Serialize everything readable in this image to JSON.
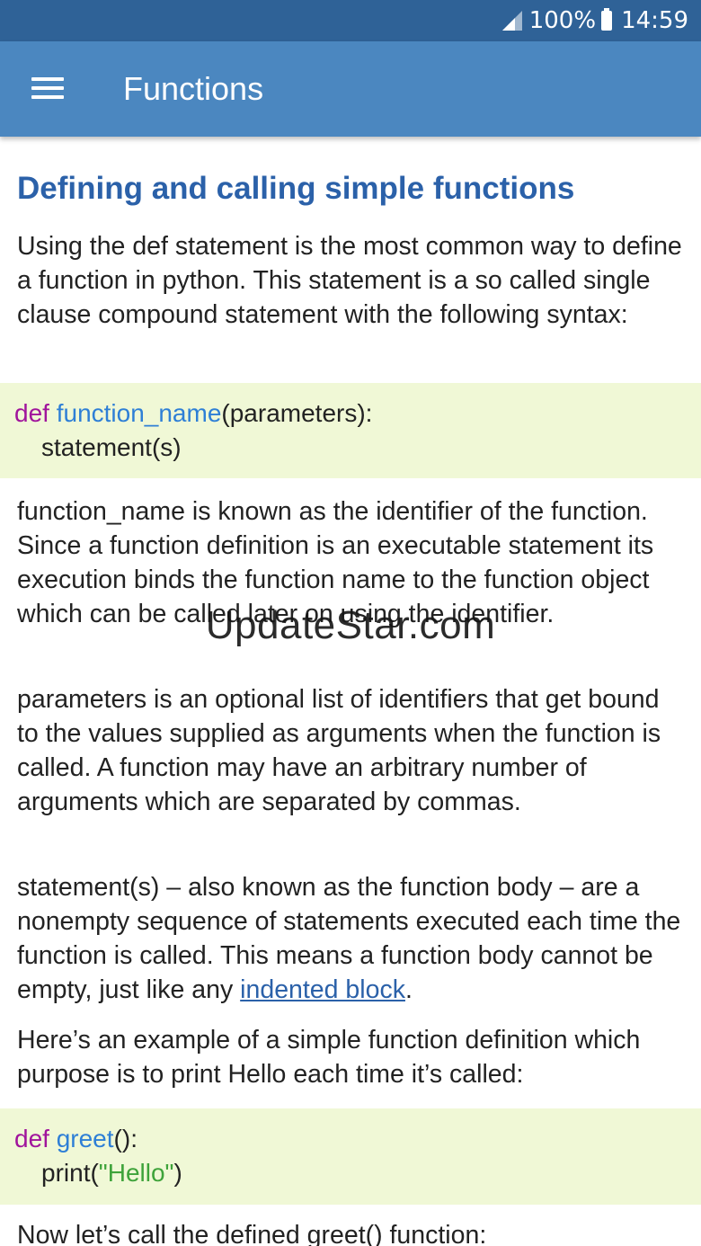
{
  "status_bar": {
    "battery_percent": "100%",
    "time": "14:59",
    "signal_icon": "signal-icon",
    "battery_icon": "battery-icon"
  },
  "app_bar": {
    "menu_icon": "hamburger-menu-icon",
    "title": "Functions"
  },
  "article": {
    "heading": "Defining and calling simple functions",
    "intro": "Using the def statement is the most common way to define a function in python. This statement is a so called single clause compound statement with the following syntax:",
    "code1": {
      "line1": {
        "kw": "def",
        "fn": " function_name",
        "rest": "(parameters):"
      },
      "line2": "statement(s)"
    },
    "para_function_name": "function_name is known as the identifier of the function. Since a function definition is an executable statement its execution binds the function name to the function object which can be called later on using the identifier.",
    "para_parameters": "parameters is an optional list of identifiers that get bound to the values supplied as arguments when the function is called. A function may have an arbitrary number of arguments which are separated by commas.",
    "para_statements": {
      "text": "statement(s) – also known as the function body – are a nonempty sequence of statements executed each time the function is called. This means a function body cannot be empty, just like any ",
      "link": "indented block",
      "end": "."
    },
    "para_example": "Here’s an example of a simple function definition which purpose is to print Hello each time it’s called:",
    "code2": {
      "line1": {
        "kw": "def",
        "fn": " greet",
        "rest": "():"
      },
      "line2": {
        "pre": "print(",
        "str": "\"Hello\"",
        "post": ")"
      }
    },
    "para_call": "Now let’s call the defined greet() function:"
  },
  "watermark": "UpdateStar.com",
  "colors": {
    "status_bar": "#2f6297",
    "app_bar": "#4b87c0",
    "heading": "#2b61a9",
    "code_bg": "#f0f8d6",
    "keyword": "#a0149c",
    "function_name": "#2e7fd6",
    "string": "#3ea33a"
  }
}
